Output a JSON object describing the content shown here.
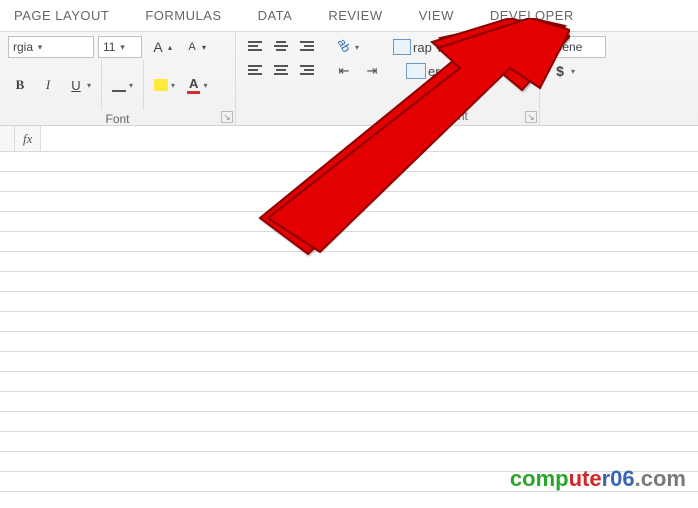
{
  "tabs": {
    "page_layout": "PAGE LAYOUT",
    "formulas": "FORMULAS",
    "data": "DATA",
    "review": "REVIEW",
    "view": "VIEW",
    "developer": "DEVELOPER"
  },
  "font_group": {
    "label": "Font",
    "font_name": "rgia",
    "font_size": "11",
    "bold": "B",
    "italic": "I",
    "underline": "U",
    "incfont": "A",
    "incfont_sup": "▴",
    "decfont": "A",
    "decfont_sup": "▾",
    "fontcolor": "A"
  },
  "align_group": {
    "label": "Alignment",
    "orientation": "ab",
    "wrap_text": "rap Text",
    "merge_center": "erge & Center"
  },
  "number_group": {
    "format": "Gene",
    "dollar": "$"
  },
  "formula_bar": {
    "fx": "fx",
    "value": ""
  },
  "watermark": {
    "t1": "comp",
    "t2": "ute",
    "t3": "r06",
    "t4": ".com"
  }
}
